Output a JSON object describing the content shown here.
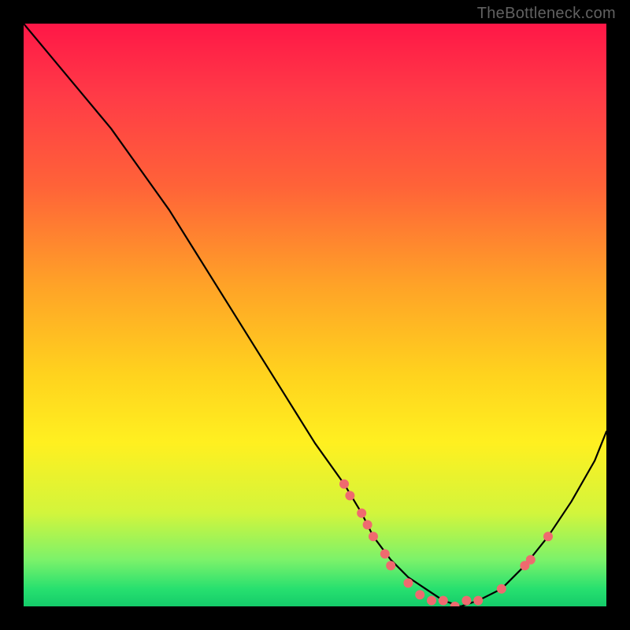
{
  "watermark": "TheBottleneck.com",
  "colors": {
    "background": "#000000",
    "curve": "#000000",
    "dot": "#ef6a6f",
    "gradient_stops": [
      "#ff1747",
      "#ff3a47",
      "#ff6338",
      "#ffa327",
      "#ffd21e",
      "#fff020",
      "#d2f53c",
      "#7cf26a",
      "#27e06f",
      "#14cc6a"
    ]
  },
  "chart_data": {
    "type": "line",
    "title": "",
    "xlabel": "",
    "ylabel": "",
    "xlim": [
      0,
      100
    ],
    "ylim": [
      0,
      100
    ],
    "grid": false,
    "legend": false,
    "series": [
      {
        "name": "curve",
        "x": [
          0,
          5,
          10,
          15,
          20,
          25,
          30,
          35,
          40,
          45,
          50,
          55,
          58,
          60,
          63,
          66,
          69,
          72,
          75,
          78,
          82,
          86,
          90,
          94,
          98,
          100
        ],
        "y": [
          100,
          94,
          88,
          82,
          75,
          68,
          60,
          52,
          44,
          36,
          28,
          21,
          16,
          12,
          8,
          5,
          3,
          1,
          0,
          1,
          3,
          7,
          12,
          18,
          25,
          30
        ]
      }
    ],
    "markers": [
      {
        "name": "cluster-left-upper",
        "x": 55,
        "y": 21
      },
      {
        "name": "cluster-left-upper",
        "x": 56,
        "y": 19
      },
      {
        "name": "cluster-left-mid",
        "x": 58,
        "y": 16
      },
      {
        "name": "cluster-left-mid",
        "x": 59,
        "y": 14
      },
      {
        "name": "cluster-left-mid",
        "x": 60,
        "y": 12
      },
      {
        "name": "cluster-left-low",
        "x": 62,
        "y": 9
      },
      {
        "name": "cluster-left-low",
        "x": 63,
        "y": 7
      },
      {
        "name": "valley-left",
        "x": 66,
        "y": 4
      },
      {
        "name": "valley-left",
        "x": 68,
        "y": 2
      },
      {
        "name": "valley-bottom",
        "x": 70,
        "y": 1
      },
      {
        "name": "valley-bottom",
        "x": 72,
        "y": 1
      },
      {
        "name": "valley-bottom",
        "x": 74,
        "y": 0
      },
      {
        "name": "valley-right",
        "x": 76,
        "y": 1
      },
      {
        "name": "valley-right",
        "x": 78,
        "y": 1
      },
      {
        "name": "rise-low",
        "x": 82,
        "y": 3
      },
      {
        "name": "rise-mid",
        "x": 86,
        "y": 7
      },
      {
        "name": "rise-mid",
        "x": 87,
        "y": 8
      },
      {
        "name": "rise-high",
        "x": 90,
        "y": 12
      }
    ]
  }
}
